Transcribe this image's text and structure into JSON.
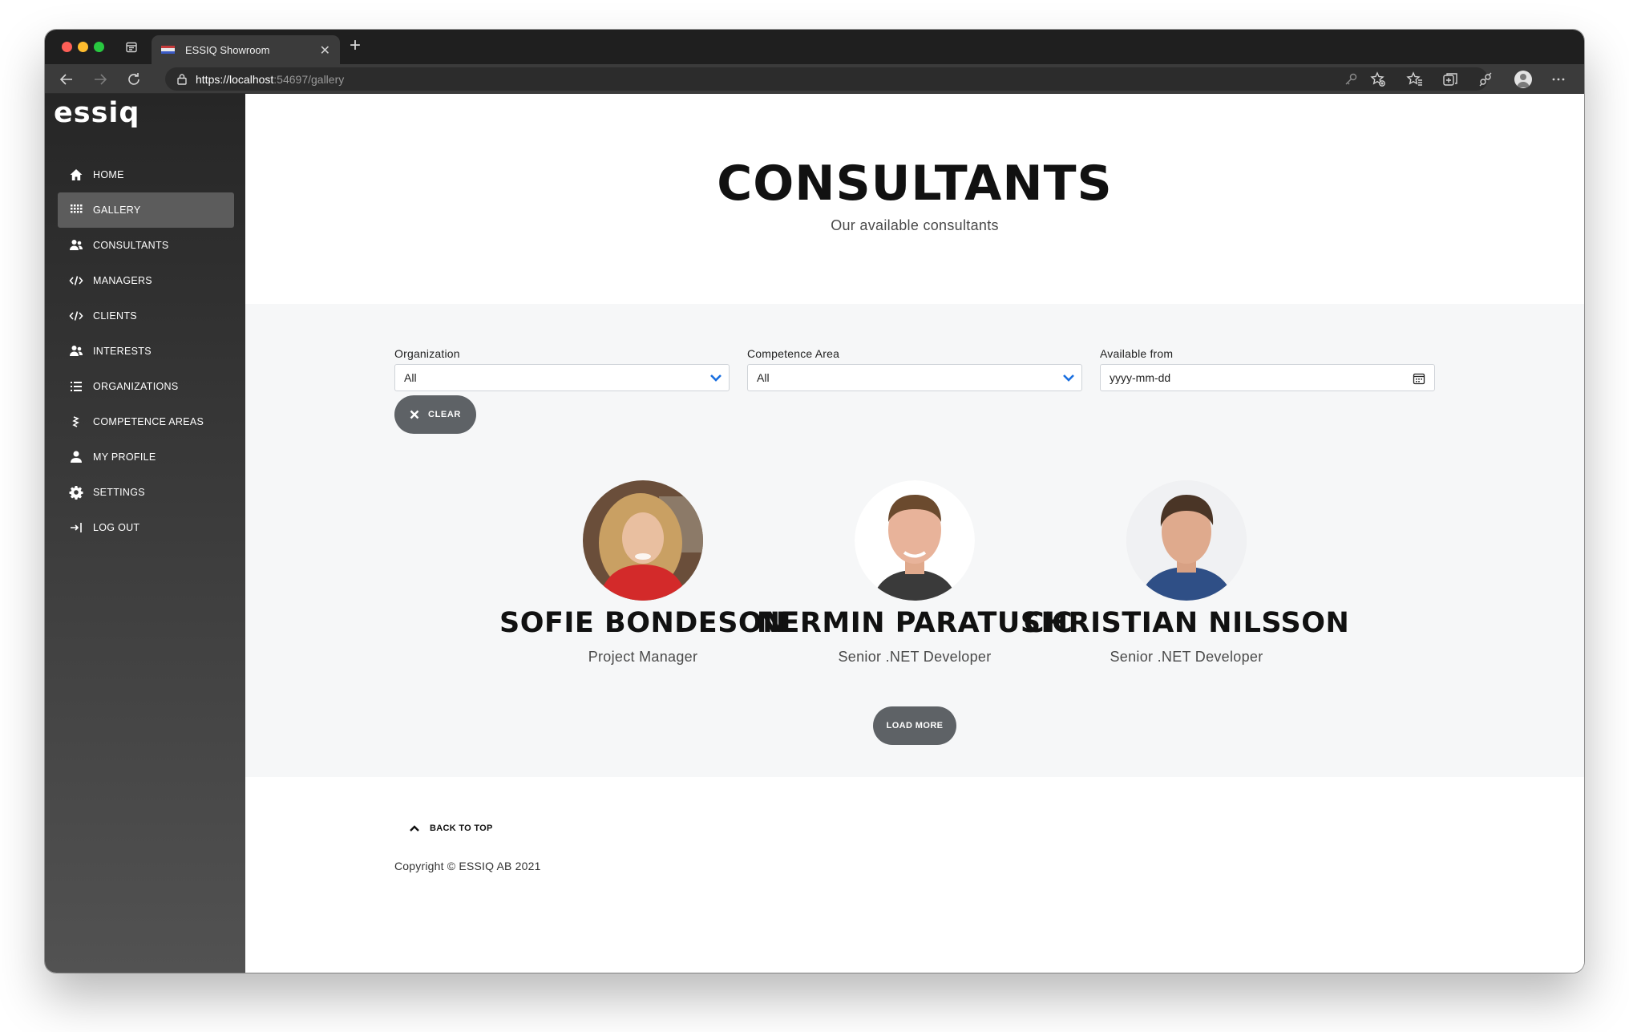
{
  "browser": {
    "tab_title": "ESSIQ Showroom",
    "url_host": "https://localhost",
    "url_rest": ":54697/gallery"
  },
  "sidebar": {
    "logo": "essiq",
    "items": [
      {
        "label": "HOME",
        "icon": "home-icon"
      },
      {
        "label": "GALLERY",
        "icon": "grid-icon",
        "active": true
      },
      {
        "label": "CONSULTANTS",
        "icon": "users-icon"
      },
      {
        "label": "MANAGERS",
        "icon": "code-icon"
      },
      {
        "label": "CLIENTS",
        "icon": "code-icon"
      },
      {
        "label": "INTERESTS",
        "icon": "users-icon"
      },
      {
        "label": "ORGANIZATIONS",
        "icon": "list-icon"
      },
      {
        "label": "COMPETENCE AREAS",
        "icon": "lightning-icon"
      },
      {
        "label": "MY PROFILE",
        "icon": "user-icon"
      },
      {
        "label": "SETTINGS",
        "icon": "gear-icon"
      },
      {
        "label": "LOG OUT",
        "icon": "logout-icon"
      }
    ]
  },
  "hero": {
    "title": "CONSULTANTS",
    "subtitle": "Our available consultants"
  },
  "filters": {
    "organization": {
      "label": "Organization",
      "value": "All"
    },
    "competence_area": {
      "label": "Competence Area",
      "value": "All"
    },
    "available_from": {
      "label": "Available from",
      "placeholder": "yyyy-mm-dd"
    },
    "clear_label": "CLEAR"
  },
  "consultants": [
    {
      "name": "SOFIE BONDESON",
      "role": "Project Manager"
    },
    {
      "name": "NERMIN PARATUSIC",
      "role": "Senior .NET Developer"
    },
    {
      "name": "CHRISTIAN NILSSON",
      "role": "Senior .NET Developer"
    }
  ],
  "load_more_label": "LOAD MORE",
  "footer": {
    "back_to_top": "BACK TO TOP",
    "copyright": "Copyright © ESSIQ AB 2021"
  },
  "colors": {
    "sidebar_top": "#262626",
    "band": "#f6f7f8",
    "button": "#5e6266",
    "chevron": "#1a6fe0"
  }
}
